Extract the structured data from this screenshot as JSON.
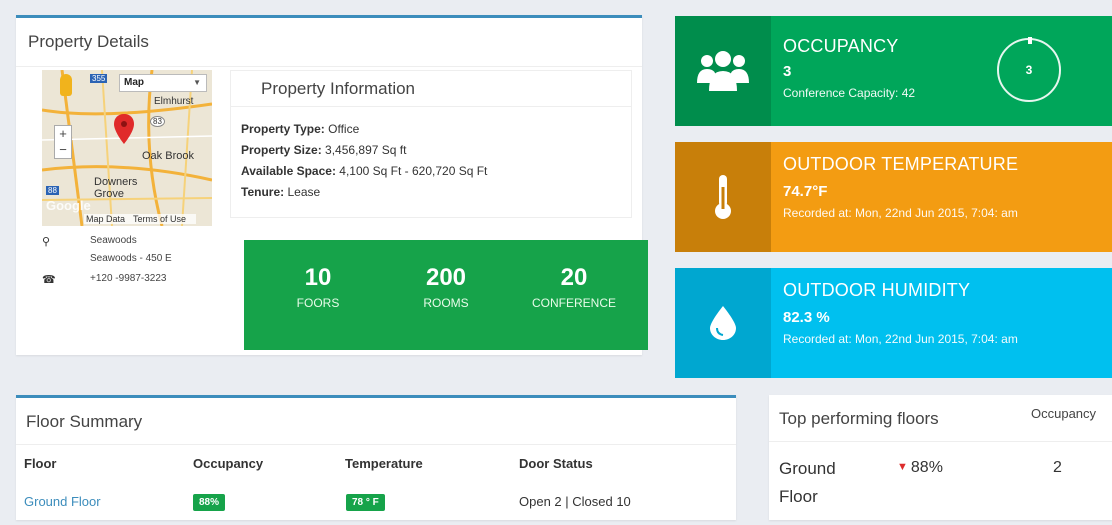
{
  "property": {
    "title": "Property Details",
    "map": {
      "type_label": "Map",
      "labels": [
        "Elmhurst",
        "Oak Brook",
        "Downers Grove",
        "Google"
      ],
      "road_numbers": [
        "355",
        "83",
        "88"
      ],
      "footer_data": "Map Data",
      "footer_terms": "Terms of Use"
    },
    "contact": {
      "address_line1": "Seawoods",
      "address_line2": "Seawoods - 450 E",
      "phone": "+120 -9987-3223"
    },
    "info": {
      "heading": "Property Information",
      "type_label": "Property Type:",
      "type_value": "Office",
      "size_label": "Property Size:",
      "size_value": "3,456,897 Sq ft",
      "space_label": "Available Space:",
      "space_value": "4,100 Sq Ft - 620,720 Sq Ft",
      "tenure_label": "Tenure:",
      "tenure_value": "Lease"
    },
    "stats": [
      {
        "value": "10",
        "label": "FOORS"
      },
      {
        "value": "200",
        "label": "ROOMS"
      },
      {
        "value": "20",
        "label": "CONFERENCE"
      }
    ]
  },
  "occupancy": {
    "title": "OCCUPANCY",
    "value": "3",
    "sub": "Conference Capacity: 42",
    "ring_value": "3",
    "icon": "users-icon"
  },
  "temperature": {
    "title": "OUTDOOR TEMPERATURE",
    "value": "74.7°F",
    "sub": "Recorded at: Mon, 22nd Jun 2015, 7:04: am",
    "icon": "thermometer-icon"
  },
  "humidity": {
    "title": "OUTDOOR HUMIDITY",
    "value": "82.3 %",
    "sub": "Recorded at: Mon, 22nd Jun 2015, 7:04: am",
    "icon": "water-drop-icon"
  },
  "floor_summary": {
    "title": "Floor Summary",
    "columns": [
      "Floor",
      "Occupancy",
      "Temperature",
      "Door Status"
    ],
    "rows": [
      {
        "floor": "Ground Floor",
        "occupancy": "88%",
        "temperature": "78 ° F",
        "door_status": "Open 2 | Closed 10"
      }
    ]
  },
  "top_floors": {
    "title": "Top performing floors",
    "occupancy_header": "Occupancy",
    "rows": [
      {
        "floor": "Ground Floor",
        "percent": "88%",
        "count": "2",
        "trend": "down"
      }
    ]
  },
  "colors": {
    "green": "#00a65a",
    "orange": "#f39c12",
    "cyan": "#00c0ef",
    "link": "#3c8dbc"
  }
}
